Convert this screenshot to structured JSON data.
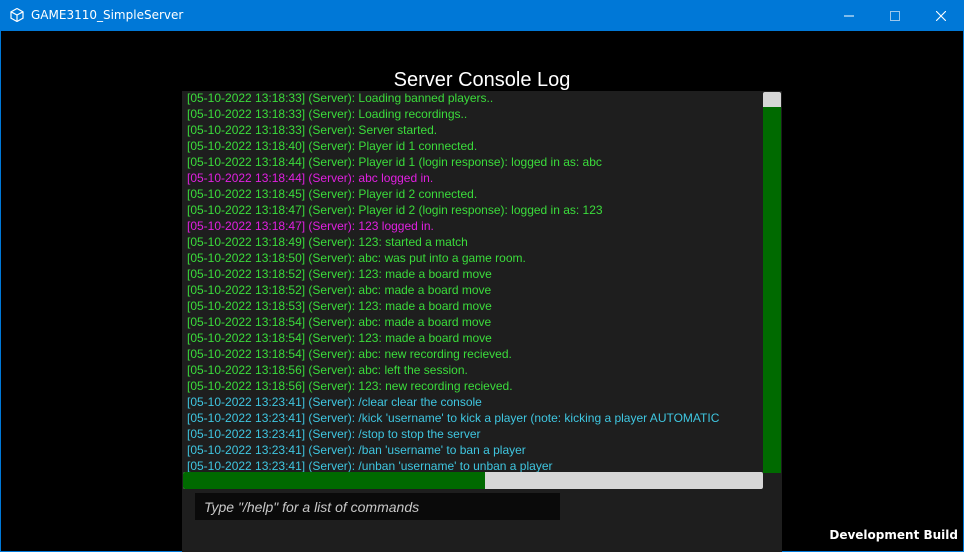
{
  "window": {
    "title": "GAME3110_SimpleServer",
    "accent_color": "#0078d7",
    "buttons": [
      "minimize-icon",
      "maximize-icon",
      "close-icon"
    ]
  },
  "console": {
    "title": "Server Console Log",
    "vertical_scroll_fraction": 1.0,
    "horizontal_scroll_visible_fraction": 0.52,
    "lines": [
      {
        "text": "[05-10-2022 13:18:33] (Server): Loading banned players..",
        "color": "green"
      },
      {
        "text": "[05-10-2022 13:18:33] (Server): Loading recordings..",
        "color": "green"
      },
      {
        "text": "[05-10-2022 13:18:33] (Server): Server started.",
        "color": "green"
      },
      {
        "text": "[05-10-2022 13:18:40] (Server): Player id 1 connected.",
        "color": "green"
      },
      {
        "text": "[05-10-2022 13:18:44] (Server): Player id 1 (login response): logged in as: abc",
        "color": "green"
      },
      {
        "text": "[05-10-2022 13:18:44] (Server): abc logged in.",
        "color": "magenta"
      },
      {
        "text": "[05-10-2022 13:18:45] (Server): Player id 2 connected.",
        "color": "green"
      },
      {
        "text": "[05-10-2022 13:18:47] (Server): Player id 2 (login response): logged in as: 123",
        "color": "green"
      },
      {
        "text": "[05-10-2022 13:18:47] (Server): 123 logged in.",
        "color": "magenta"
      },
      {
        "text": "[05-10-2022 13:18:49] (Server): 123: started a match",
        "color": "green"
      },
      {
        "text": "[05-10-2022 13:18:50] (Server): abc: was put into a game room.",
        "color": "green"
      },
      {
        "text": "[05-10-2022 13:18:52] (Server): 123: made a board move",
        "color": "green"
      },
      {
        "text": "[05-10-2022 13:18:52] (Server): abc: made a board move",
        "color": "green"
      },
      {
        "text": "[05-10-2022 13:18:53] (Server): 123: made a board move",
        "color": "green"
      },
      {
        "text": "[05-10-2022 13:18:54] (Server): abc: made a board move",
        "color": "green"
      },
      {
        "text": "[05-10-2022 13:18:54] (Server): 123: made a board move",
        "color": "green"
      },
      {
        "text": "[05-10-2022 13:18:54] (Server): abc: new recording recieved.",
        "color": "green"
      },
      {
        "text": "[05-10-2022 13:18:56] (Server): abc: left the session.",
        "color": "green"
      },
      {
        "text": "[05-10-2022 13:18:56] (Server): 123: new recording recieved.",
        "color": "green"
      },
      {
        "text": "[05-10-2022 13:23:41] (Server): /clear clear the console",
        "color": "cyan"
      },
      {
        "text": "[05-10-2022 13:23:41] (Server): /kick 'username' to kick a player (note: kicking a player AUTOMATIC",
        "color": "cyan"
      },
      {
        "text": "[05-10-2022 13:23:41] (Server): /stop to stop the server",
        "color": "cyan"
      },
      {
        "text": "[05-10-2022 13:23:41] (Server): /ban 'username' to ban a player",
        "color": "cyan"
      },
      {
        "text": "[05-10-2022 13:23:41] (Server): /unban 'username' to unban a player",
        "color": "cyan"
      }
    ]
  },
  "command_input": {
    "placeholder": "Type \"/help\" for a list of commands",
    "value": ""
  },
  "footer": {
    "build_label": "Development Build"
  },
  "colors": {
    "green": "#3bdc3b",
    "magenta": "#e020e0",
    "cyan": "#3fc6e0",
    "scroll_thumb": "#006a00"
  }
}
